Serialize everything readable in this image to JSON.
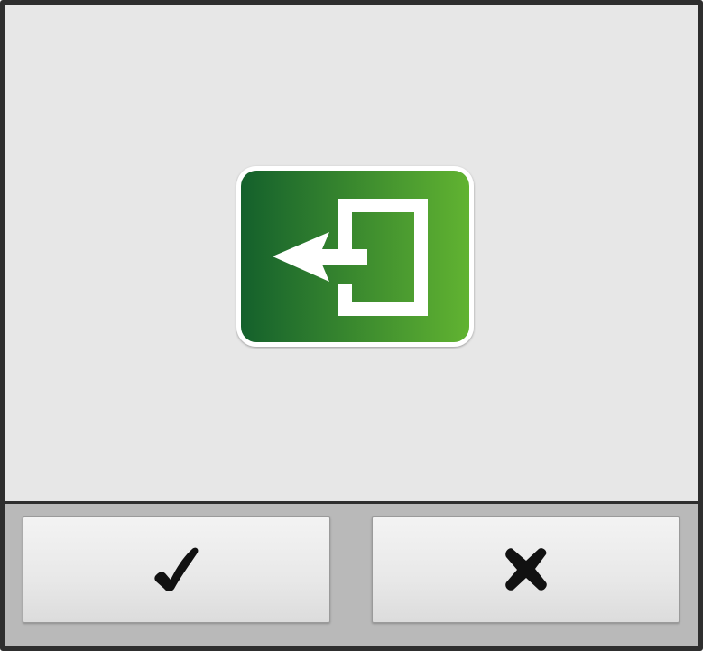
{
  "dialog": {
    "icon": "exit-door-arrow-icon",
    "icon_colors": {
      "gradient_start": "#14602c",
      "gradient_end": "#61b331",
      "glyph": "#ffffff"
    }
  },
  "buttons": {
    "confirm": {
      "icon": "checkmark-icon"
    },
    "cancel": {
      "icon": "cross-icon"
    }
  },
  "colors": {
    "frame": "#2e2e2e",
    "content_background": "#e7e7e7",
    "button_bar_background": "#b9b9b9"
  }
}
